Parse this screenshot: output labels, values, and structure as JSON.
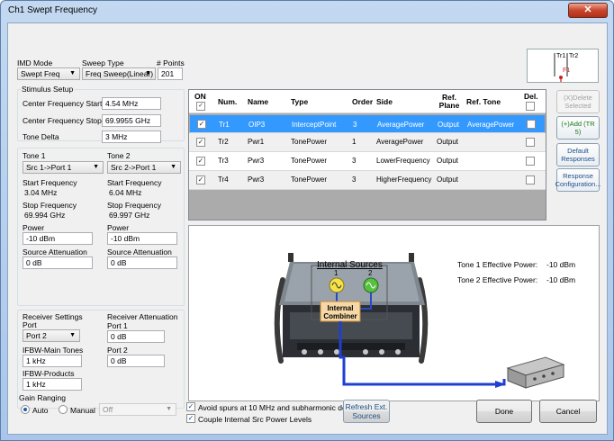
{
  "window": {
    "title": "Ch1 Swept Frequency",
    "close_glyph": "✕"
  },
  "sweep": {
    "imd_mode_label": "IMD Mode",
    "imd_mode_value": "Swept Freq",
    "sweep_type_label": "Sweep Type",
    "sweep_type_value": "Freq Sweep(Linear)",
    "points_label": "# Points",
    "points_value": "201"
  },
  "stimulus": {
    "group_label": "Stimulus Setup",
    "center_start_label": "Center Frequency Start",
    "center_start_value": "4.54 MHz",
    "center_stop_label": "Center Frequency Stop",
    "center_stop_value": "69.9955 GHz",
    "tone_delta_label": "Tone Delta",
    "tone_delta_value": "3 MHz"
  },
  "tone1": {
    "label": "Tone 1",
    "source": "Src 1->Port 1",
    "start_label": "Start Frequency",
    "start_value": "3.04 MHz",
    "stop_label": "Stop Frequency",
    "stop_value": "69.994 GHz",
    "power_label": "Power",
    "power_value": "-10 dBm",
    "atten_label": "Source Attenuation",
    "atten_value": "0 dB"
  },
  "tone2": {
    "label": "Tone 2",
    "source": "Src 2->Port 1",
    "start_label": "Start Frequency",
    "start_value": "6.04 MHz",
    "stop_label": "Stop Frequency",
    "stop_value": "69.997 GHz",
    "power_label": "Power",
    "power_value": "-10 dBm",
    "atten_label": "Source Attenuation",
    "atten_value": "0 dB"
  },
  "receiver": {
    "settings_label": "Receiver Settings",
    "port_label": "Port",
    "port_value": "Port 2",
    "ifbw_main_label": "IFBW-Main Tones",
    "ifbw_main_value": "1 kHz",
    "ifbw_prod_label": "IFBW-Products",
    "ifbw_prod_value": "1 kHz",
    "atten_label": "Receiver Attenuation",
    "port1_label": "Port 1",
    "port1_value": "0 dB",
    "port2_label": "Port 2",
    "port2_value": "0 dB"
  },
  "gain": {
    "label": "Gain Ranging",
    "auto_label": "Auto",
    "manual_label": "Manual",
    "off_value": "Off"
  },
  "table": {
    "headers": {
      "on": "ON",
      "num": "Num.",
      "name": "Name",
      "type": "Type",
      "order": "Order",
      "side": "Side",
      "ref_plane": "Ref. Plane",
      "ref_tone": "Ref. Tone",
      "del": "Del."
    },
    "rows": [
      {
        "num": "Tr1",
        "name": "OIP3",
        "type": "InterceptPoint",
        "order": "3",
        "side": "AveragePower",
        "plane": "Output",
        "tone": "AveragePower"
      },
      {
        "num": "Tr2",
        "name": "Pwr1",
        "type": "TonePower",
        "order": "1",
        "side": "AveragePower",
        "plane": "Output",
        "tone": ""
      },
      {
        "num": "Tr3",
        "name": "Pwr3",
        "type": "TonePower",
        "order": "3",
        "side": "LowerFrequency",
        "plane": "Output",
        "tone": ""
      },
      {
        "num": "Tr4",
        "name": "Pwr3",
        "type": "TonePower",
        "order": "3",
        "side": "HigherFrequency",
        "plane": "Output",
        "tone": ""
      }
    ]
  },
  "side_buttons": {
    "delete": "(X)Delete Selected",
    "add": "(+)Add (TR 5)",
    "default": "Default Responses",
    "response": "Response Configuration..."
  },
  "preview": {
    "trace1": "Tr1",
    "trace2": "Tr2",
    "marker": "F1"
  },
  "diagram": {
    "internal_sources": "Internal Sources",
    "src1": "1",
    "src2": "2",
    "combiner": "Internal Combiner",
    "tone1_eff_label": "Tone 1 Effective Power:",
    "tone1_eff_value": "-10 dBm",
    "tone2_eff_label": "Tone 2 Effective Power:",
    "tone2_eff_value": "-10 dBm"
  },
  "footer": {
    "avoid_spurs": "Avoid spurs at 10 MHz and subharmonic deltas",
    "couple": "Couple Internal Src Power Levels",
    "refresh": "Refresh Ext. Sources",
    "done": "Done",
    "cancel": "Cancel"
  }
}
